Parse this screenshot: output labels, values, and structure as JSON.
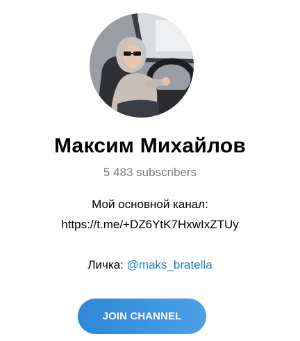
{
  "channel": {
    "name": "Максим Михайлов",
    "subscribers": "5 483 subscribers",
    "description_line1": "Мой основной канал:",
    "description_link": "https://t.me/+DZ6YtK7HxwIxZTUy",
    "contact_label": "Личка: ",
    "contact_handle": "@maks_bratella"
  },
  "actions": {
    "join_label": "JOIN CHANNEL"
  },
  "colors": {
    "link": "#2481cc",
    "button_start": "#2f88d6",
    "button_end": "#4ca0e6",
    "muted_text": "#7d7f81"
  },
  "icons": {
    "avatar": "channel-avatar-photo"
  }
}
